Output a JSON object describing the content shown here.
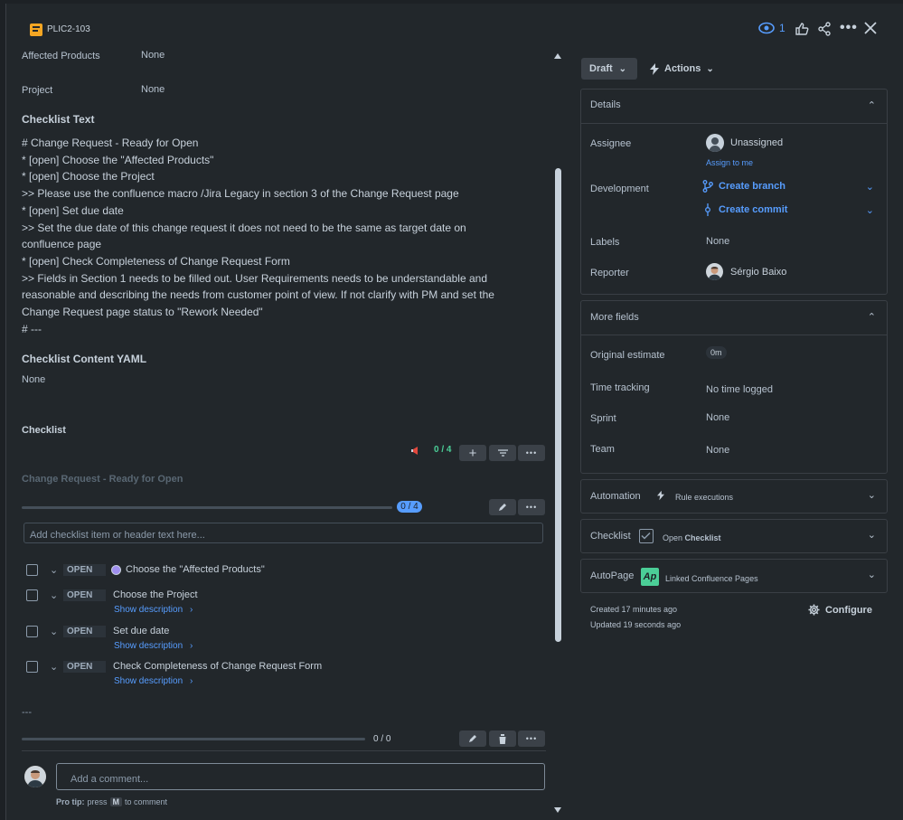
{
  "header": {
    "issue_key": "PLIC2-103",
    "watch_count": "1"
  },
  "fields": {
    "affected_products": {
      "label": "Affected Products",
      "value": "None"
    },
    "project": {
      "label": "Project",
      "value": "None"
    }
  },
  "checklist_text": {
    "heading": "Checklist Text",
    "lines": [
      "# Change Request - Ready for Open",
      "* [open] Choose the \"Affected Products\"",
      "* [open] Choose the Project",
      ">> Please use the confluence macro /Jira Legacy in section 3 of the Change Request page",
      "* [open] Set due date",
      ">> Set the due date of this change request it does not need to be the same as target date on",
      "confluence page",
      "* [open] Check Completeness of Change Request Form",
      ">> Fields in Section 1 needs to be filled out. User Requirements needs to be understandable and",
      "reasonable and describing the needs from customer point of view. If not clarify with PM and set the",
      "Change Request page status to \"Rework Needed\"",
      "# ---"
    ]
  },
  "checklist_yaml": {
    "heading": "Checklist Content YAML",
    "value": "None"
  },
  "checklist": {
    "heading": "Checklist",
    "progress": "0 / 4",
    "group_title": "Change Request - Ready for Open",
    "group_progress": "0 / 4",
    "add_placeholder": "Add checklist item or header text here...",
    "items": [
      {
        "status": "OPEN",
        "text": "Choose the \"Affected Products\"",
        "desc": ""
      },
      {
        "status": "OPEN",
        "text": "Choose the Project",
        "desc": "Show description"
      },
      {
        "status": "OPEN",
        "text": "Set due date",
        "desc": "Show description"
      },
      {
        "status": "OPEN",
        "text": "Check Completeness of Change Request Form",
        "desc": "Show description"
      }
    ],
    "separator": "---",
    "second_progress": "0 / 0"
  },
  "comment": {
    "placeholder": "Add a comment...",
    "protip_prefix": "Pro tip:",
    "protip_press": "press",
    "protip_key": "M",
    "protip_suffix": "to comment"
  },
  "sidebar": {
    "status_button": "Draft",
    "actions_button": "Actions",
    "details": {
      "title": "Details",
      "assignee_label": "Assignee",
      "assignee_value": "Unassigned",
      "assign_to_me": "Assign to me",
      "development_label": "Development",
      "create_branch": "Create branch",
      "create_commit": "Create commit",
      "labels_label": "Labels",
      "labels_value": "None",
      "reporter_label": "Reporter",
      "reporter_value": "Sérgio Baixo"
    },
    "more_fields": {
      "title": "More fields",
      "original_estimate_label": "Original estimate",
      "original_estimate_value": "0m",
      "time_tracking_label": "Time tracking",
      "time_tracking_value": "No time logged",
      "sprint_label": "Sprint",
      "sprint_value": "None",
      "team_label": "Team",
      "team_value": "None"
    },
    "automation": {
      "title": "Automation",
      "value": "Rule executions"
    },
    "checklist_panel": {
      "title": "Checklist",
      "value_prefix": "Open ",
      "value_bold": "Checklist"
    },
    "autopage": {
      "title": "AutoPage",
      "value": "Linked Confluence Pages"
    },
    "created": "Created 17 minutes ago",
    "updated": "Updated 19 seconds ago",
    "configure": "Configure"
  },
  "colors": {
    "background": "#22272b",
    "link": "#579dff",
    "progress_badge": "#579dff",
    "progress_count": "#4bce97"
  }
}
